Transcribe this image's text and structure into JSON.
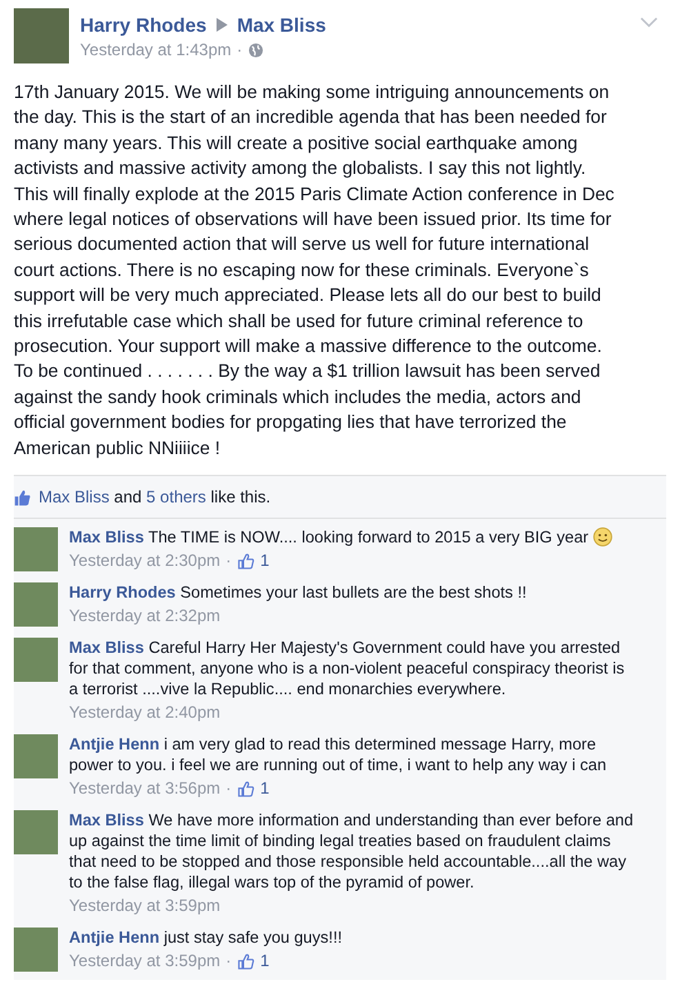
{
  "post": {
    "author": "Harry Rhodes",
    "target": "Max Bliss",
    "time": "Yesterday at 1:43pm",
    "separator": "·",
    "lines": [
      "17th January 2015. We will be making some intriguing announcements on",
      "the day. This is the start of an incredible agenda that has been needed for",
      "many many years. This will create a positive social earthquake among",
      "activists and massive activity among the globalists. I say this not lightly.",
      "This will finally explode at the 2015 Paris Climate Action conference in Dec",
      "where legal notices of observations will have been issued prior. Its time for",
      "serious documented action that will serve us well for future international",
      "court actions. There is no escaping now for these criminals. Everyone`s",
      "support will be very much appreciated. Please lets all do our best to build",
      "this irrefutable case which shall be used for future criminal reference to",
      "prosecution. Your support will make a massive difference to the outcome.",
      "To be continued . . . . . . . By the way a $1 trillion lawsuit has been served",
      "against the sandy hook criminals which includes the media, actors and",
      "official government bodies for propgating lies that have terrorized the",
      "American public NNiiiice !"
    ]
  },
  "likes": {
    "name": "Max Bliss",
    "and": " and ",
    "others": "5 others",
    "suffix": " like this."
  },
  "comments": [
    {
      "author": "Max Bliss",
      "text": "The TIME is NOW.... looking forward to 2015 a very BIG year",
      "emoji": true,
      "time": "Yesterday at 2:30pm",
      "separator": "·",
      "likes": "1"
    },
    {
      "author": "Harry Rhodes",
      "text": "Sometimes your last bullets are the best shots !!",
      "emoji": false,
      "time": "Yesterday at 2:32pm"
    },
    {
      "author": "Max Bliss",
      "text": "Careful Harry Her Majesty's Government could have you arrested for that comment, anyone who is a non-violent peaceful conspiracy theorist is a terrorist ....vive la Republic.... end monarchies everywhere.",
      "emoji": false,
      "time": "Yesterday at 2:40pm"
    },
    {
      "author": "Antjie Henn",
      "text": "i am very glad to read this determined message Harry, more power to you. i feel we are running out of time, i want to help any way i can",
      "emoji": false,
      "time": "Yesterday at 3:56pm",
      "separator": "·",
      "likes": "1"
    },
    {
      "author": "Max Bliss",
      "text": "We have more information and understanding than ever before and up against the time limit of binding legal treaties based on fraudulent claims that need to be stopped and those responsible held accountable....all the way to the false flag, illegal wars top of the pyramid of power.",
      "emoji": false,
      "time": "Yesterday at 3:59pm"
    },
    {
      "author": "Antjie Henn",
      "text": "just stay safe you guys!!!",
      "emoji": false,
      "time": "Yesterday at 3:59pm",
      "separator": "·",
      "likes": "1"
    }
  ]
}
